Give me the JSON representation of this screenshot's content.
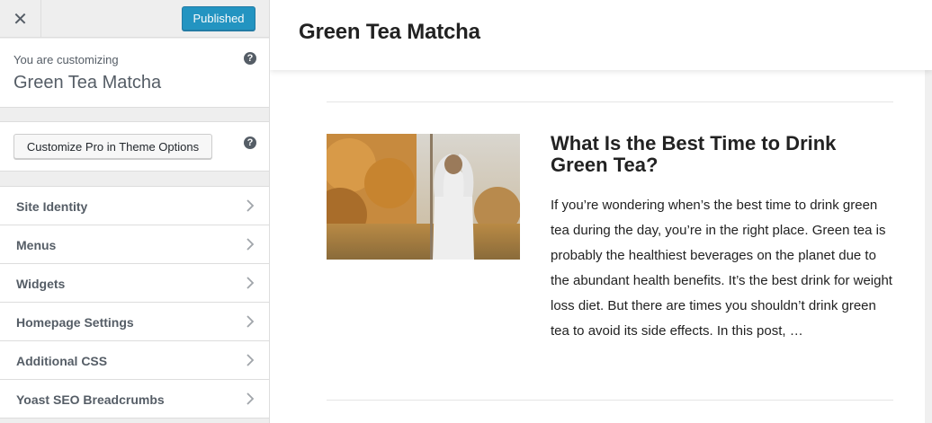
{
  "topbar": {
    "close_glyph": "✕",
    "publish_label": "Published"
  },
  "info_panel": {
    "customizing_label": "You are customizing",
    "site_name": "Green Tea Matcha",
    "help_glyph": "?"
  },
  "pro_panel": {
    "button_label": "Customize Pro in Theme Options",
    "help_glyph": "?"
  },
  "menu": {
    "items": [
      {
        "label": "Site Identity",
        "icon": "chevron-right-icon"
      },
      {
        "label": "Menus",
        "icon": "chevron-right-icon"
      },
      {
        "label": "Widgets",
        "icon": "chevron-right-icon"
      },
      {
        "label": "Homepage Settings",
        "icon": "chevron-right-icon"
      },
      {
        "label": "Additional CSS",
        "icon": "chevron-right-icon"
      },
      {
        "label": "Yoast SEO Breadcrumbs",
        "icon": "chevron-right-icon"
      }
    ]
  },
  "preview": {
    "site_title": "Green Tea Matcha",
    "post": {
      "title": "What Is the Best Time to Drink Green Tea?",
      "excerpt": "If you’re wondering when’s the best time to drink green tea during the day, you’re in the right place. Green tea is probably the healthiest beverages on the planet due to the abundant health benefits. It’s the best drink for weight loss diet. But there are times you shouldn’t drink green tea to avoid its side effects. In this post, …"
    }
  },
  "colors": {
    "accent": "#0085ba",
    "sidebar_bg": "#eeeeee",
    "text": "#555d66"
  }
}
